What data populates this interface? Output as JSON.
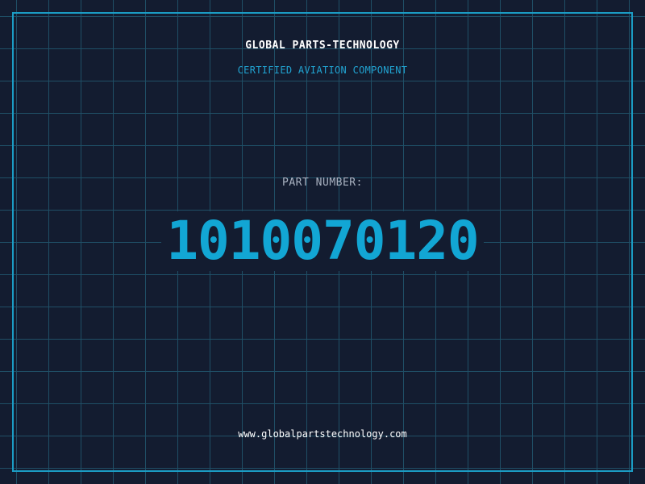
{
  "header": {
    "company": "GLOBAL PARTS-TECHNOLOGY",
    "subtitle": "CERTIFIED AVIATION COMPONENT"
  },
  "part": {
    "label": "PART NUMBER:",
    "number": "1010070120"
  },
  "footer": {
    "website": "www.globalpartstechnology.com"
  },
  "colors": {
    "background": "#131c30",
    "grid": "#1f4f66",
    "border": "#1b9cc4",
    "accent": "#12a6d4",
    "label": "#aab3c2",
    "text": "#ffffff"
  }
}
